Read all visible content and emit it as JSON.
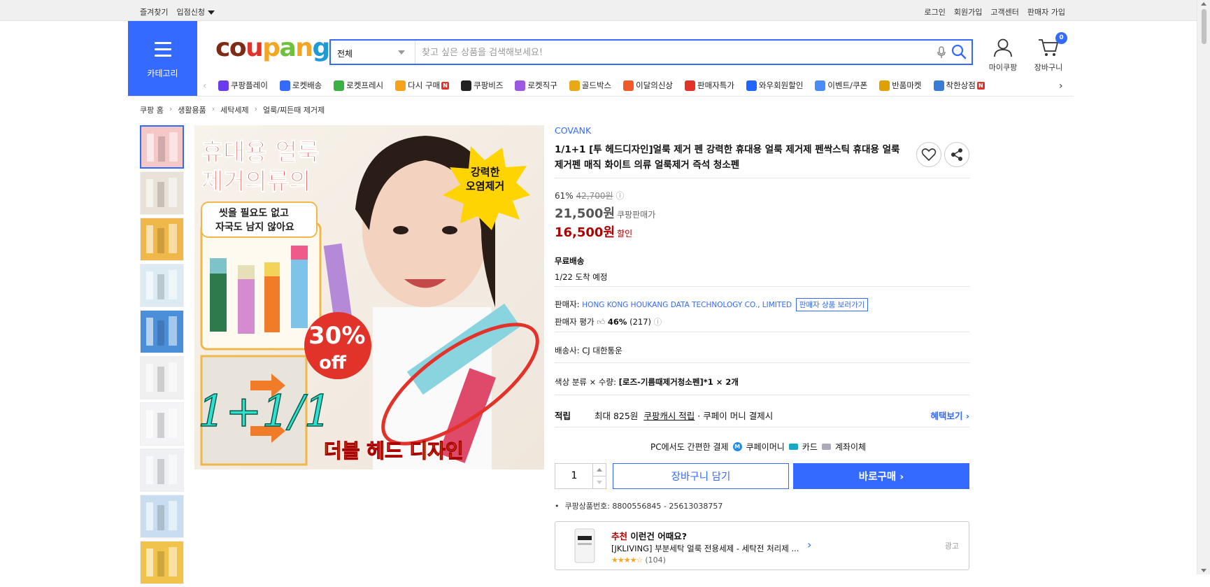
{
  "topbar": {
    "left": [
      "즐겨찾기",
      "입점신청"
    ],
    "right": [
      "로그인",
      "회원가입",
      "고객센터",
      "판매자 가입"
    ]
  },
  "header": {
    "category_label": "카테고리",
    "logo_text": "coupang",
    "search_scope": "전체",
    "search_placeholder": "찾고 싶은 상품을 검색해보세요!",
    "my_coupang": "마이쿠팡",
    "cart_label": "장바구니",
    "cart_count": "0"
  },
  "catnav": [
    {
      "label": "쿠팡플레이",
      "color": "#6a3cf0",
      "new": false
    },
    {
      "label": "로켓배송",
      "color": "#346aff",
      "new": false
    },
    {
      "label": "로켓프레시",
      "color": "#3cb043",
      "new": false
    },
    {
      "label": "다시 구매",
      "color": "#f7a21b",
      "new": true
    },
    {
      "label": "쿠팡비즈",
      "color": "#222222",
      "new": false
    },
    {
      "label": "로켓직구",
      "color": "#9b58e0",
      "new": false
    },
    {
      "label": "골드박스",
      "color": "#e8a81a",
      "new": false
    },
    {
      "label": "이달의신상",
      "color": "#f05a28",
      "new": false
    },
    {
      "label": "판매자특가",
      "color": "#e2332a",
      "new": false
    },
    {
      "label": "와우회원할인",
      "color": "#1e66ff",
      "new": false
    },
    {
      "label": "이벤트/쿠폰",
      "color": "#4b8bf5",
      "new": false
    },
    {
      "label": "반품마켓",
      "color": "#e0a100",
      "new": false
    },
    {
      "label": "착한상점",
      "color": "#3a7bd5",
      "new": true
    }
  ],
  "breadcrumb": [
    "쿠팡 홈",
    "생활용품",
    "세탁세제",
    "얼룩/찌든때 제거제"
  ],
  "gallery": {
    "banner_title": "휴대용 얼룩\n제거의류의",
    "banner_sub": "씻을 필요도 없고\n자국도 남지 않아요",
    "badge_text": "강력한\n오염제거",
    "sale_text": "30%\noff",
    "promo_text": "1+1/1",
    "design_text": "더블 헤드 디자인",
    "thumb_colors": [
      "#f5c8c8",
      "#e9e2d8",
      "#f0b84a",
      "#dcebf2",
      "#4b8fd8",
      "#f0f0f0",
      "#f4f4f6",
      "#eef0f4",
      "#c8def0",
      "#f2c34b"
    ]
  },
  "product": {
    "brand": "COVANK",
    "title": "1/1+1 [투 헤드디자인]얼룩 제거 펜 강력한 휴대용 얼룩 제거제 펜싹스틱 휴대용 얼룩제거펜 매직 화이트 의류 얼룩제거 즉석 청소펜",
    "discount_rate": "61%",
    "original_price": "42,700원",
    "coupang_price": "21,500원",
    "coupang_price_label": "쿠팡판매가",
    "sale_price": "16,500원",
    "sale_price_label": "할인",
    "shipping_title": "무료배송",
    "arrival": "1/22 도착 예정",
    "seller_label": "판매자:",
    "seller_name": "HONG KONG HOUKANG DATA TECHNOLOGY CO., LIMITED",
    "seller_button": "판매자 상품 보러가기",
    "rating_label": "판매자 평가",
    "rating_pct": "46%",
    "rating_count": "(217)",
    "delivery_label": "배송사:",
    "delivery_company": "CJ 대한통운",
    "option_label": "색상 분류 × 수량:",
    "option_value": "[로즈-기름때제거청소펜]*1 × 2개",
    "reward_label": "적립",
    "reward_text": "최대 825원",
    "reward_link": "쿠팡캐시 적립",
    "reward_tail": "· 쿠페이 머니 결제시",
    "benefit_link": "혜택보기",
    "pay_intro": "PC에서도 간편한 결제",
    "pay_methods": [
      "쿠페이머니",
      "카드",
      "계좌이체"
    ],
    "quantity": "1",
    "add_cart": "장바구니 담기",
    "buy_now": "바로구매",
    "product_number": "쿠팡상품번호: 8800556845 - 25613038757"
  },
  "recommend": {
    "prefix": "추천",
    "heading": "이런건 어때요?",
    "title": "[JKLIVING] 부분세탁 얼룩 전용세제 - 세탁전 처리제 ...",
    "stars": "★★★★☆",
    "count": "(104)",
    "ad": "광고"
  },
  "colors": {
    "accent": "#346aff",
    "sale": "#ae0000"
  }
}
